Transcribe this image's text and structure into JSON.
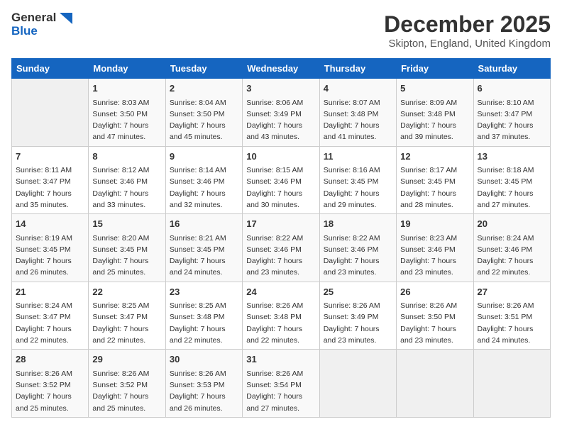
{
  "logo": {
    "line1": "General",
    "line2": "Blue"
  },
  "title": "December 2025",
  "subtitle": "Skipton, England, United Kingdom",
  "days_of_week": [
    "Sunday",
    "Monday",
    "Tuesday",
    "Wednesday",
    "Thursday",
    "Friday",
    "Saturday"
  ],
  "weeks": [
    [
      {
        "day": "",
        "info": ""
      },
      {
        "day": "1",
        "info": "Sunrise: 8:03 AM\nSunset: 3:50 PM\nDaylight: 7 hours\nand 47 minutes."
      },
      {
        "day": "2",
        "info": "Sunrise: 8:04 AM\nSunset: 3:50 PM\nDaylight: 7 hours\nand 45 minutes."
      },
      {
        "day": "3",
        "info": "Sunrise: 8:06 AM\nSunset: 3:49 PM\nDaylight: 7 hours\nand 43 minutes."
      },
      {
        "day": "4",
        "info": "Sunrise: 8:07 AM\nSunset: 3:48 PM\nDaylight: 7 hours\nand 41 minutes."
      },
      {
        "day": "5",
        "info": "Sunrise: 8:09 AM\nSunset: 3:48 PM\nDaylight: 7 hours\nand 39 minutes."
      },
      {
        "day": "6",
        "info": "Sunrise: 8:10 AM\nSunset: 3:47 PM\nDaylight: 7 hours\nand 37 minutes."
      }
    ],
    [
      {
        "day": "7",
        "info": "Sunrise: 8:11 AM\nSunset: 3:47 PM\nDaylight: 7 hours\nand 35 minutes."
      },
      {
        "day": "8",
        "info": "Sunrise: 8:12 AM\nSunset: 3:46 PM\nDaylight: 7 hours\nand 33 minutes."
      },
      {
        "day": "9",
        "info": "Sunrise: 8:14 AM\nSunset: 3:46 PM\nDaylight: 7 hours\nand 32 minutes."
      },
      {
        "day": "10",
        "info": "Sunrise: 8:15 AM\nSunset: 3:46 PM\nDaylight: 7 hours\nand 30 minutes."
      },
      {
        "day": "11",
        "info": "Sunrise: 8:16 AM\nSunset: 3:45 PM\nDaylight: 7 hours\nand 29 minutes."
      },
      {
        "day": "12",
        "info": "Sunrise: 8:17 AM\nSunset: 3:45 PM\nDaylight: 7 hours\nand 28 minutes."
      },
      {
        "day": "13",
        "info": "Sunrise: 8:18 AM\nSunset: 3:45 PM\nDaylight: 7 hours\nand 27 minutes."
      }
    ],
    [
      {
        "day": "14",
        "info": "Sunrise: 8:19 AM\nSunset: 3:45 PM\nDaylight: 7 hours\nand 26 minutes."
      },
      {
        "day": "15",
        "info": "Sunrise: 8:20 AM\nSunset: 3:45 PM\nDaylight: 7 hours\nand 25 minutes."
      },
      {
        "day": "16",
        "info": "Sunrise: 8:21 AM\nSunset: 3:45 PM\nDaylight: 7 hours\nand 24 minutes."
      },
      {
        "day": "17",
        "info": "Sunrise: 8:22 AM\nSunset: 3:46 PM\nDaylight: 7 hours\nand 23 minutes."
      },
      {
        "day": "18",
        "info": "Sunrise: 8:22 AM\nSunset: 3:46 PM\nDaylight: 7 hours\nand 23 minutes."
      },
      {
        "day": "19",
        "info": "Sunrise: 8:23 AM\nSunset: 3:46 PM\nDaylight: 7 hours\nand 23 minutes."
      },
      {
        "day": "20",
        "info": "Sunrise: 8:24 AM\nSunset: 3:46 PM\nDaylight: 7 hours\nand 22 minutes."
      }
    ],
    [
      {
        "day": "21",
        "info": "Sunrise: 8:24 AM\nSunset: 3:47 PM\nDaylight: 7 hours\nand 22 minutes."
      },
      {
        "day": "22",
        "info": "Sunrise: 8:25 AM\nSunset: 3:47 PM\nDaylight: 7 hours\nand 22 minutes."
      },
      {
        "day": "23",
        "info": "Sunrise: 8:25 AM\nSunset: 3:48 PM\nDaylight: 7 hours\nand 22 minutes."
      },
      {
        "day": "24",
        "info": "Sunrise: 8:26 AM\nSunset: 3:48 PM\nDaylight: 7 hours\nand 22 minutes."
      },
      {
        "day": "25",
        "info": "Sunrise: 8:26 AM\nSunset: 3:49 PM\nDaylight: 7 hours\nand 23 minutes."
      },
      {
        "day": "26",
        "info": "Sunrise: 8:26 AM\nSunset: 3:50 PM\nDaylight: 7 hours\nand 23 minutes."
      },
      {
        "day": "27",
        "info": "Sunrise: 8:26 AM\nSunset: 3:51 PM\nDaylight: 7 hours\nand 24 minutes."
      }
    ],
    [
      {
        "day": "28",
        "info": "Sunrise: 8:26 AM\nSunset: 3:52 PM\nDaylight: 7 hours\nand 25 minutes."
      },
      {
        "day": "29",
        "info": "Sunrise: 8:26 AM\nSunset: 3:52 PM\nDaylight: 7 hours\nand 25 minutes."
      },
      {
        "day": "30",
        "info": "Sunrise: 8:26 AM\nSunset: 3:53 PM\nDaylight: 7 hours\nand 26 minutes."
      },
      {
        "day": "31",
        "info": "Sunrise: 8:26 AM\nSunset: 3:54 PM\nDaylight: 7 hours\nand 27 minutes."
      },
      {
        "day": "",
        "info": ""
      },
      {
        "day": "",
        "info": ""
      },
      {
        "day": "",
        "info": ""
      }
    ]
  ]
}
